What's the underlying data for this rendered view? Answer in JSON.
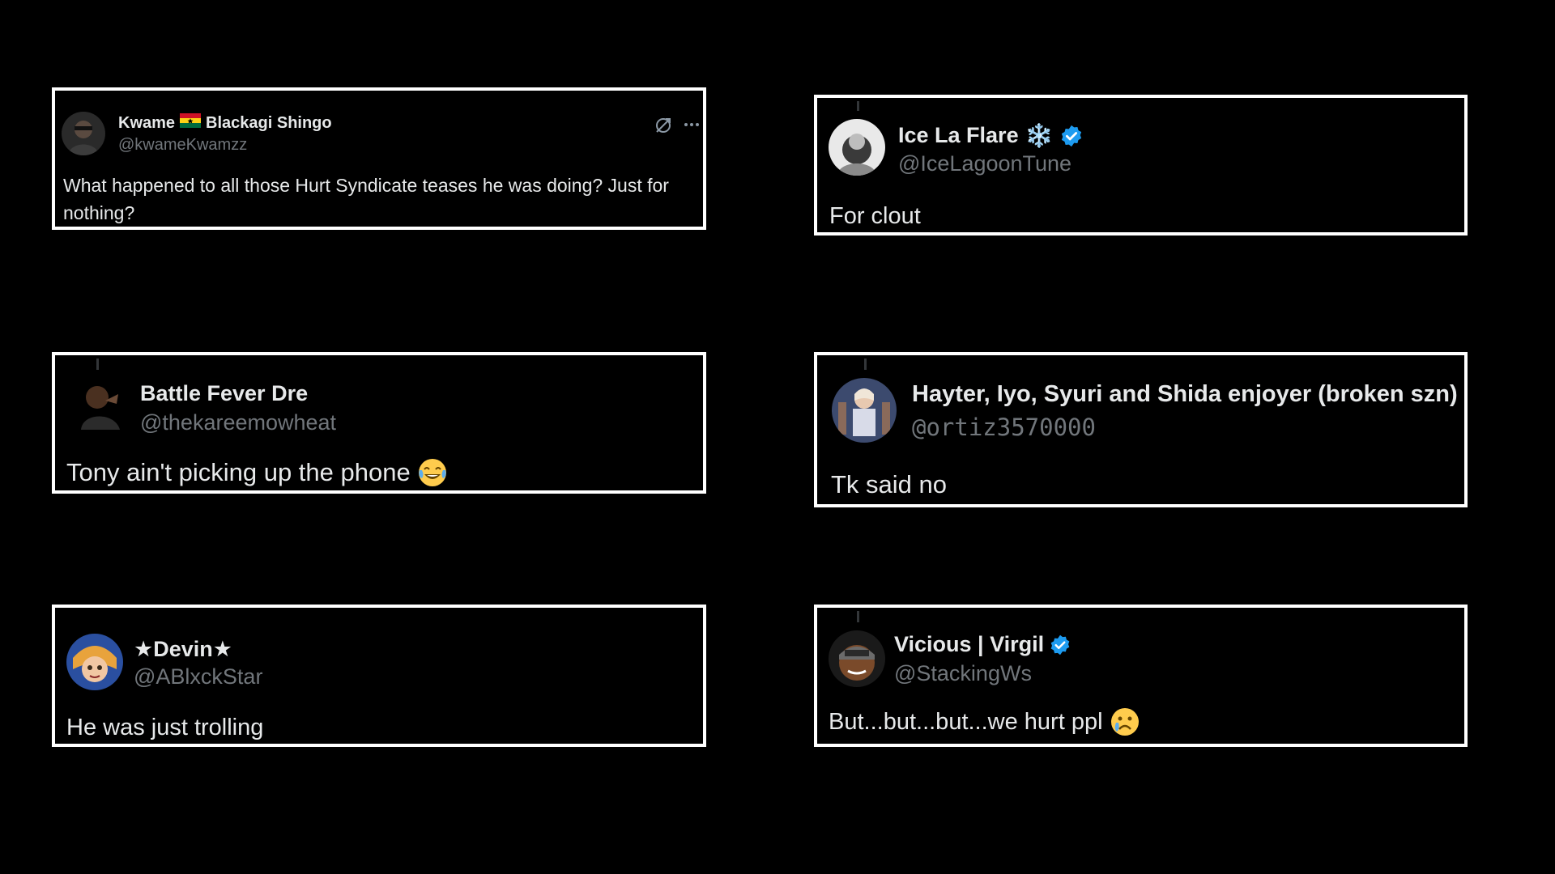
{
  "tweets": [
    {
      "name_part1": "Kwame",
      "flag": "ghana-flag-icon",
      "name_part2": "Blackagi Shingo",
      "handle": "@kwameKwamzz",
      "text_line1": "What happened to all those Hurt Syndicate teases he was doing? Just for",
      "text_line2": "nothing?",
      "icons": [
        "grok-icon",
        "more-icon"
      ]
    },
    {
      "name": "Ice La Flare",
      "name_emoji": "❄️",
      "verified": true,
      "handle": "@IceLagoonTune",
      "text": "For clout"
    },
    {
      "name": "Battle Fever Dre",
      "handle": "@thekareemowheat",
      "text": "Tony ain't picking up the phone",
      "emoji": "face-with-tears-of-joy"
    },
    {
      "name": "Hayter, Iyo, Syuri and Shida enjoyer (broken szn)",
      "handle": "@ortiz3570000",
      "text": "Tk said no"
    },
    {
      "name": "★Devin★",
      "handle": "@ABlxckStar",
      "text": "He was just trolling"
    },
    {
      "name": "Vicious | Virgil",
      "verified": true,
      "handle": "@StackingWs",
      "text": "But...but...but...we hurt ppl",
      "emoji": "crying-face"
    }
  ],
  "colors": {
    "background": "#000000",
    "border": "#ffffff",
    "text": "#e7e9ea",
    "muted": "#71767b",
    "verified": "#1d9bf0"
  }
}
